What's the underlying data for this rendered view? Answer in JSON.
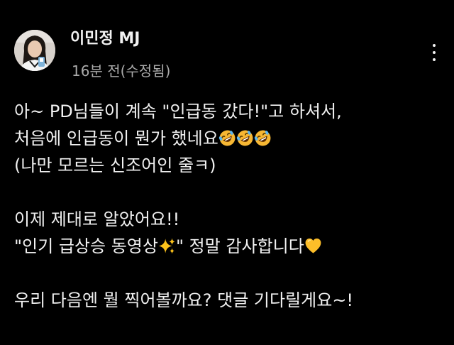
{
  "post": {
    "author_name": "이민정 MJ",
    "timestamp": "16분 전(수정됨)",
    "more_icon": "more-vertical-icon",
    "lines": {
      "l1": "아~ PD님들이 계속 \"인급동 갔다!\"고 하셔서,",
      "l2": "처음에 인급동이 뭔가 했네요",
      "l3": "(나만 모르는 신조어인 줄ㅋ)",
      "l4": "이제 제대로 알았어요!!",
      "l5a": "\"인기 급상승 동영상",
      "l5b": "\" 정말 감사합니다",
      "l6": "우리 다음엔 뭘 찍어볼까요? 댓글 기다릴게요~!"
    },
    "emojis": {
      "laughing": "rolling-on-floor-laughing-emoji",
      "sparkles": "sparkles-emoji",
      "heart": "yellow-heart-emoji"
    },
    "colors": {
      "background": "#000000",
      "text": "#f1f1f1",
      "secondary_text": "#aaaaaa"
    }
  }
}
